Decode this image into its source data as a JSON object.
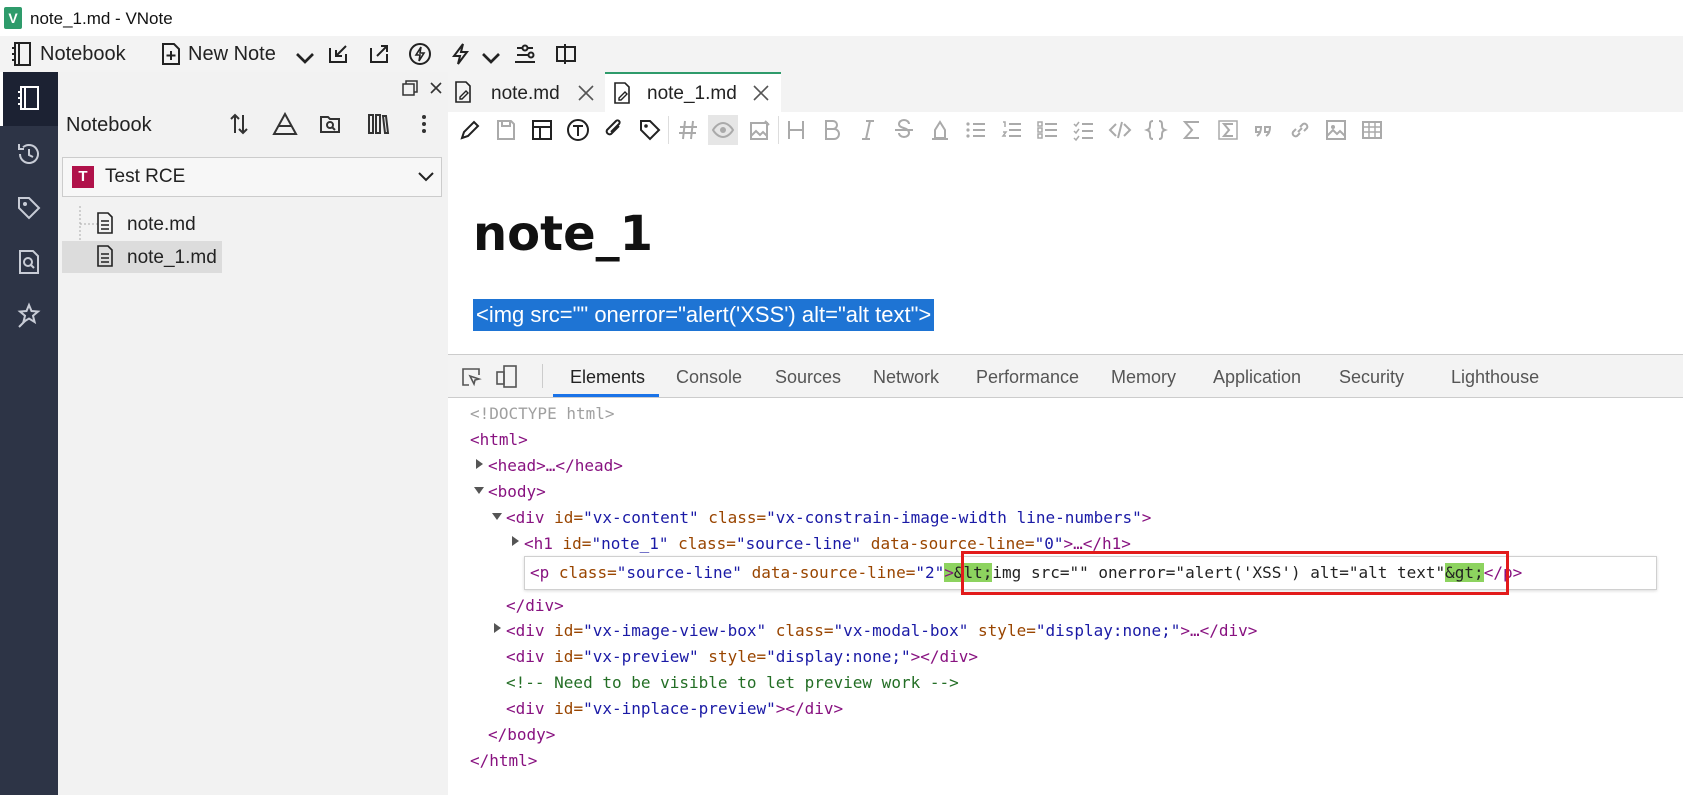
{
  "window": {
    "title": "note_1.md - VNote",
    "logo_letter": "V"
  },
  "main_toolbar": {
    "notebook_label": "Notebook",
    "new_note_label": "New Note"
  },
  "activity_bar": {
    "icons": [
      "notebook-icon",
      "history-icon",
      "tag-icon",
      "search-icon",
      "magic-icon"
    ]
  },
  "sidebar": {
    "heading": "Notebook",
    "notebook": {
      "badge": "T",
      "name": "Test RCE"
    },
    "tree": [
      {
        "label": "note.md"
      },
      {
        "label": "note_1.md",
        "selected": true
      }
    ]
  },
  "tabs": [
    {
      "label": "note.md",
      "active": false
    },
    {
      "label": "note_1.md",
      "active": true
    }
  ],
  "editor": {
    "title": "note_1",
    "paragraph": "<img src=\"\" onerror=\"alert('XSS') alt=\"alt text\">"
  },
  "devtools": {
    "tabs": [
      "Elements",
      "Console",
      "Sources",
      "Network",
      "Performance",
      "Memory",
      "Application",
      "Security",
      "Lighthouse"
    ],
    "active_tab": "Elements",
    "dom": {
      "doctype": "<!DOCTYPE html>",
      "html_open": "<html>",
      "head": "<head>…</head>",
      "body_open": "<body>",
      "div_content_tag": "<div ",
      "div_content_id_attr": "id=",
      "div_content_id_val": "\"vx-content\"",
      "div_content_class_attr": " class=",
      "div_content_class_val": "\"vx-constrain-image-width line-numbers\"",
      "h1_tag": "<h1 ",
      "h1_id_attr": "id=",
      "h1_id_val": "\"note_1\"",
      "h1_class_attr": " class=",
      "h1_class_val": "\"source-line\"",
      "h1_data_attr": " data-source-line=",
      "h1_data_val": "\"0\"",
      "h1_close": ">…</h1>",
      "p_tag": "<p ",
      "p_class_attr": "class=",
      "p_class_val": "\"source-line\"",
      "p_data_attr": " data-source-line=",
      "p_data_val": "\"2\"",
      "p_gt": ">",
      "p_lt_entity": "&lt;",
      "p_text": "img src=\"\" onerror=\"alert('XSS') alt=\"alt text\"",
      "p_gt_entity": "&gt;",
      "p_close": "</p>",
      "div_close": "</div>",
      "div_image_tag": "<div ",
      "div_image_id_attr": "id=",
      "div_image_id_val": "\"vx-image-view-box\"",
      "div_image_class_attr": " class=",
      "div_image_class_val": "\"vx-modal-box\"",
      "div_image_style_attr": " style=",
      "div_image_style_val": "\"display:none;\"",
      "div_image_close": ">…</div>",
      "div_preview_tag": "<div ",
      "div_preview_id_attr": "id=",
      "div_preview_id_val": "\"vx-preview\"",
      "div_preview_style_attr": " style=",
      "div_preview_style_val": "\"display:none;\"",
      "div_preview_close": "></div>",
      "comment": "<!-- Need to be visible to let preview work -->",
      "div_inplace_tag": "<div ",
      "div_inplace_id_attr": "id=",
      "div_inplace_id_val": "\"vx-inplace-preview\"",
      "div_inplace_close": "></div>",
      "body_close": "</body>",
      "html_close": "</html>"
    }
  },
  "colors": {
    "accent": "#2e9b6b",
    "activity_bar": "#2d3446",
    "selection": "#1e74d4",
    "highlight": "#8dd35f",
    "annotation_box": "#e21b1b"
  }
}
